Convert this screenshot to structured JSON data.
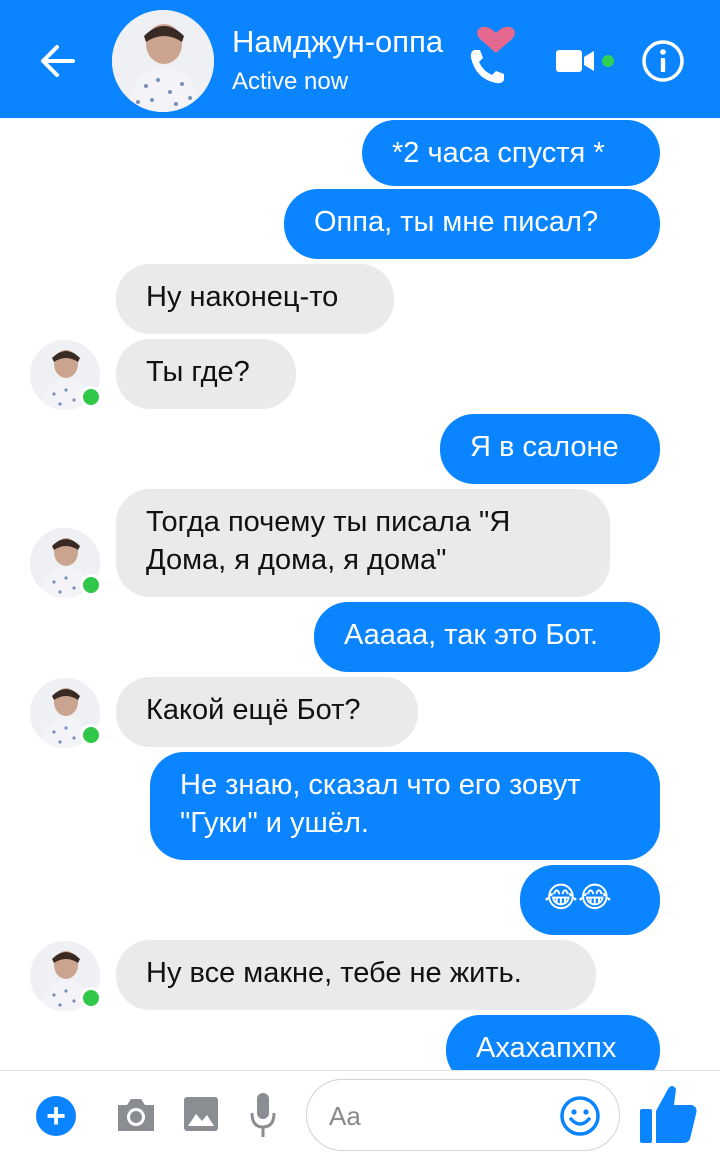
{
  "header": {
    "title": "Намджун-оппа",
    "status": "Active now",
    "accent_color": "#0a84ff"
  },
  "messages": [
    {
      "side": "out",
      "text": "*2 часа спустя *"
    },
    {
      "side": "out",
      "text": "Оппа, ты мне писал?"
    },
    {
      "side": "in",
      "text": "Ну наконец-то"
    },
    {
      "side": "in",
      "text": "Ты где?"
    },
    {
      "side": "out",
      "text": "Я в салоне"
    },
    {
      "side": "in",
      "line1": "Тогда почему ты писала \"Я",
      "line2": "Дома, я дома, я дома\""
    },
    {
      "side": "out",
      "text": "Ааааа, так это Бот."
    },
    {
      "side": "in",
      "text": "Какой ещё Бот?"
    },
    {
      "side": "out",
      "line1": "Не знаю, сказал что его зовут",
      "line2": "\"Гуки\" и ушёл."
    },
    {
      "side": "out",
      "text": "😂😂"
    },
    {
      "side": "in",
      "text": "Ну все макне, тебе не жить."
    },
    {
      "side": "out",
      "text": "Ахахапхпх"
    }
  ],
  "composer": {
    "placeholder": "Aa"
  },
  "icons": [
    "back-arrow-icon",
    "heart-icon",
    "phone-icon",
    "video-camera-icon",
    "info-icon",
    "plus-icon",
    "camera-icon",
    "image-icon",
    "microphone-icon",
    "smiley-icon",
    "thumbs-up-icon"
  ]
}
